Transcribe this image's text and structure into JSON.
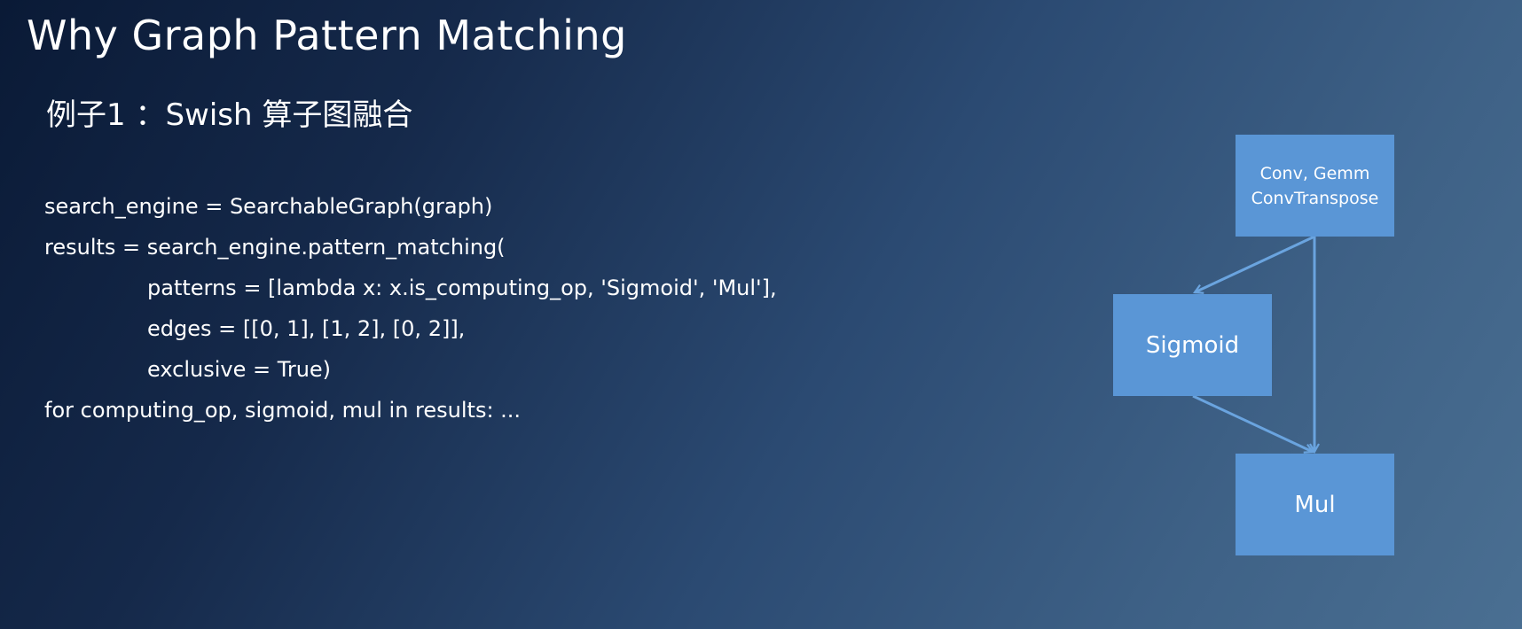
{
  "title": "Why Graph Pattern Matching",
  "subtitle": "例子1 ：Swish 算子图融合",
  "code": {
    "lines": [
      "search_engine = SearchableGraph(graph)",
      "results = search_engine.pattern_matching(",
      "patterns = [lambda x: x.is_computing_op, 'Sigmoid', 'Mul'],",
      "edges = [[0, 1], [1, 2], [0, 2]],",
      "exclusive = True)",
      "for computing_op, sigmoid, mul in results: ..."
    ]
  },
  "diagram": {
    "nodes": {
      "conv": {
        "line1": "Conv, Gemm",
        "line2": "ConvTranspose"
      },
      "sigmoid": {
        "label": "Sigmoid"
      },
      "mul": {
        "label": "Mul"
      }
    },
    "edges": [
      {
        "from": "conv",
        "to": "sigmoid"
      },
      {
        "from": "sigmoid",
        "to": "mul"
      },
      {
        "from": "conv",
        "to": "mul"
      }
    ],
    "colors": {
      "node_fill": "#5a96d6",
      "edge": "#6aa4df"
    }
  }
}
